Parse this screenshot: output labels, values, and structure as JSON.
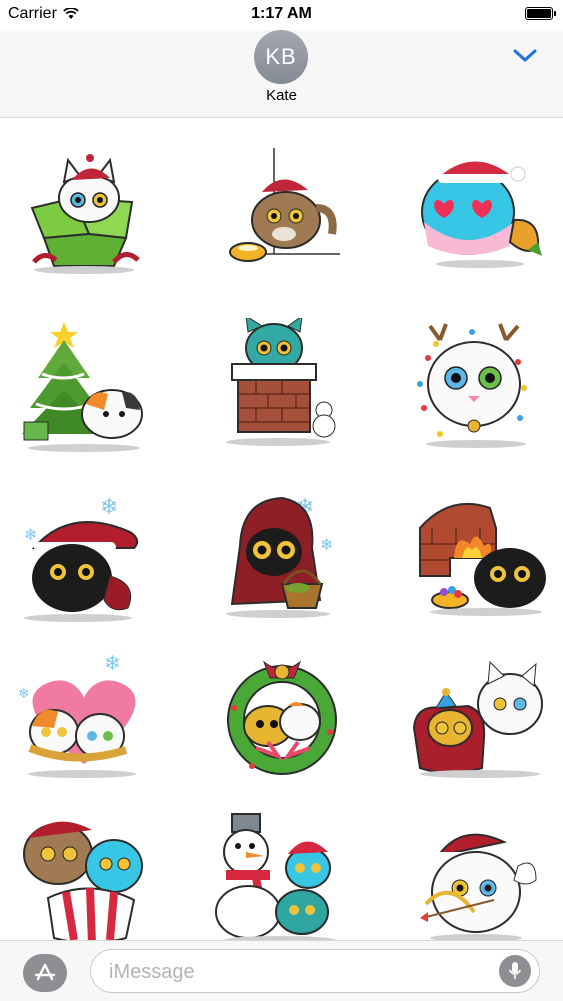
{
  "status_bar": {
    "carrier": "Carrier",
    "time": "1:17 AM"
  },
  "header": {
    "avatar_initials": "KB",
    "contact_name": "Kate"
  },
  "stickers": [
    {
      "name": "cat-in-gift-box"
    },
    {
      "name": "cat-with-food-bowl"
    },
    {
      "name": "cat-heart-eyes"
    },
    {
      "name": "cat-christmas-tree"
    },
    {
      "name": "cat-chimney"
    },
    {
      "name": "cat-lights-antlers"
    },
    {
      "name": "black-cat-santa-hat"
    },
    {
      "name": "black-cat-red-hood"
    },
    {
      "name": "black-cat-fireplace"
    },
    {
      "name": "cats-heart-scarf"
    },
    {
      "name": "cat-wreath"
    },
    {
      "name": "cats-sleeping-bag"
    },
    {
      "name": "cats-candy-sack"
    },
    {
      "name": "cats-snowman"
    },
    {
      "name": "cat-cupid"
    }
  ],
  "compose": {
    "placeholder": "iMessage"
  },
  "colors": {
    "accent": "#1a74e8"
  }
}
